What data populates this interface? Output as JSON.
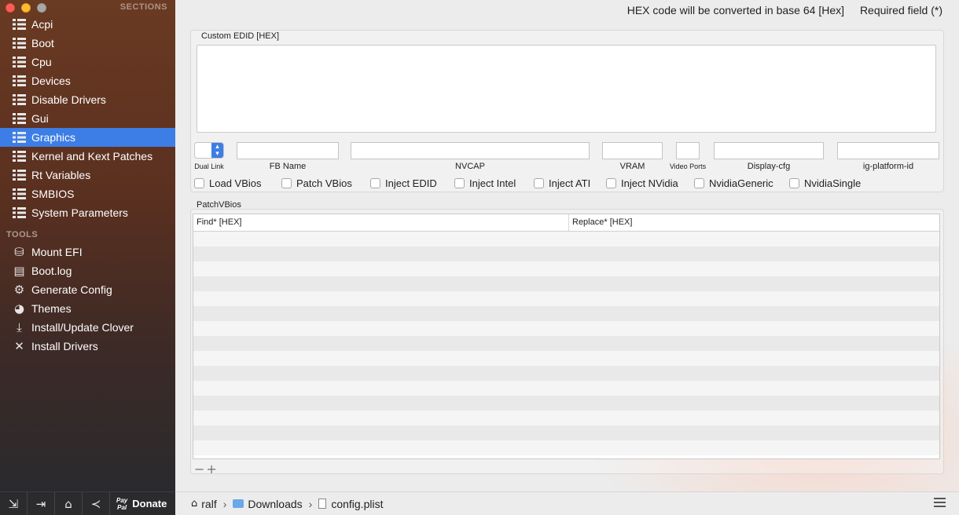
{
  "sidebar": {
    "sections_header": "SECTIONS",
    "tools_header": "TOOLS",
    "sections": [
      {
        "label": "Acpi"
      },
      {
        "label": "Boot"
      },
      {
        "label": "Cpu"
      },
      {
        "label": "Devices"
      },
      {
        "label": "Disable Drivers"
      },
      {
        "label": "Gui"
      },
      {
        "label": "Graphics",
        "active": true
      },
      {
        "label": "Kernel and Kext Patches"
      },
      {
        "label": "Rt Variables"
      },
      {
        "label": "SMBIOS"
      },
      {
        "label": "System Parameters"
      }
    ],
    "tools": [
      {
        "label": "Mount EFI",
        "icon": "disk-icon"
      },
      {
        "label": "Boot.log",
        "icon": "log-icon"
      },
      {
        "label": "Generate Config",
        "icon": "gears-icon"
      },
      {
        "label": "Themes",
        "icon": "palette-icon"
      },
      {
        "label": "Install/Update Clover",
        "icon": "download-icon"
      },
      {
        "label": "Install Drivers",
        "icon": "tools-icon"
      }
    ],
    "bottom": {
      "paypal": "Pay Pal",
      "donate": "Donate"
    }
  },
  "main": {
    "hex_note": "HEX code will be converted in base 64 [Hex]",
    "required_note": "Required field (*)",
    "edid_title": "Custom EDID [HEX]",
    "labels": {
      "dual_link": "Dual Link",
      "fb_name": "FB Name",
      "nvcap": "NVCAP",
      "vram": "VRAM",
      "video_ports": "Video Ports",
      "display_cfg": "Display-cfg",
      "ig_platform_id": "ig-platform-id"
    },
    "checkboxes": [
      "Load VBios",
      "Patch VBios",
      "Inject EDID",
      "Inject Intel",
      "Inject ATI",
      "Inject NVidia",
      "NvidiaGeneric",
      "NvidiaSingle"
    ],
    "patch_title": "PatchVBios",
    "patch_columns": [
      "Find* [HEX]",
      "Replace* [HEX]"
    ],
    "table_buttons": "−+"
  },
  "pathbar": {
    "home": "ralf",
    "folder": "Downloads",
    "file": "config.plist"
  },
  "colors": {
    "accent": "#3d7ee6"
  }
}
